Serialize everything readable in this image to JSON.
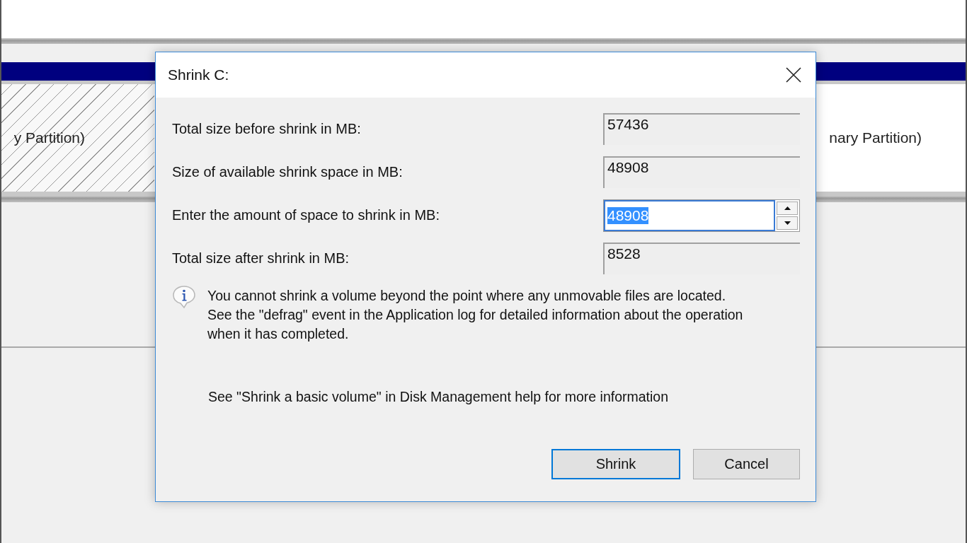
{
  "background": {
    "partitions": [
      {
        "label": "y Partition)",
        "kind": "hatched"
      },
      {
        "label": "nary Partition)",
        "kind": "plain"
      }
    ]
  },
  "dialog": {
    "title": "Shrink C:",
    "fields": [
      {
        "label": "Total size before shrink in MB:",
        "value": "57436",
        "kind": "readonly",
        "text_selected": false
      },
      {
        "label": "Size of available shrink space in MB:",
        "value": "48908",
        "kind": "readonly",
        "text_selected": false
      },
      {
        "label": "Enter the amount of space to shrink in MB:",
        "value": "48908",
        "kind": "spin",
        "text_selected": true
      },
      {
        "label": "Total size after shrink in MB:",
        "value": "8528",
        "kind": "readonly",
        "text_selected": false
      }
    ],
    "info": "You cannot shrink a volume beyond the point where any unmovable files are located. See the \"defrag\" event in the Application log for detailed information about the operation when it has completed.",
    "help": "See \"Shrink a basic volume\" in Disk Management help for more information",
    "buttons": [
      {
        "label": "Shrink",
        "default": true
      },
      {
        "label": "Cancel",
        "default": false
      }
    ]
  }
}
